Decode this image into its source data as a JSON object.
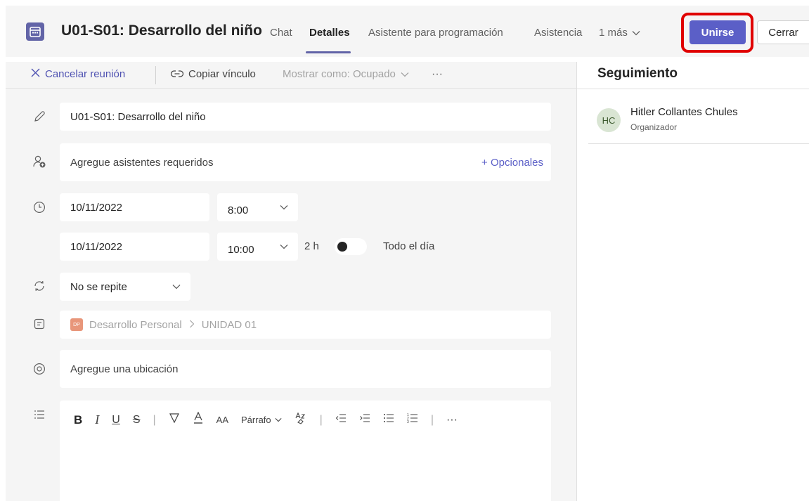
{
  "header": {
    "title": "U01-S01: Desarrollo del niño",
    "tabs": [
      {
        "label": "Chat"
      },
      {
        "label": "Detalles"
      },
      {
        "label": "Asistente para programación"
      },
      {
        "label": "Asistencia"
      }
    ],
    "active_tab": "Detalles",
    "more_tabs": "1 más",
    "join_label": "Unirse",
    "close_label": "Cerrar"
  },
  "toolbar": {
    "cancel_label": "Cancelar reunión",
    "copy_label": "Copiar vínculo",
    "show_as_label": "Mostrar como: Ocupado",
    "more_label": "···"
  },
  "form": {
    "title_value": "U01-S01: Desarrollo del niño",
    "attendees_placeholder": "Agregue asistentes requeridos",
    "optional_label": "+ Opcionales",
    "start_date": "10/11/2022",
    "start_time": "8:00",
    "end_date": "10/11/2022",
    "end_time": "10:00",
    "duration": "2 h",
    "all_day_label": "Todo el día",
    "all_day_on": false,
    "repeat_value": "No se repite",
    "channel_badge": "DP",
    "channel_team": "Desarrollo Personal",
    "channel_name": "UNIDAD 01",
    "location_placeholder": "Agregue una ubicación"
  },
  "editor": {
    "bold": "B",
    "italic": "I",
    "underline": "U",
    "strike": "S",
    "font_size": "AA",
    "paragraph": "Párrafo",
    "more": "···"
  },
  "tracking": {
    "title": "Seguimiento",
    "attendees": [
      {
        "initials": "HC",
        "name": "Hitler Collantes Chules",
        "role": "Organizador"
      }
    ]
  },
  "colors": {
    "accent": "#5b5fc7",
    "highlight": "#e00000",
    "panel": "#f5f5f5"
  }
}
